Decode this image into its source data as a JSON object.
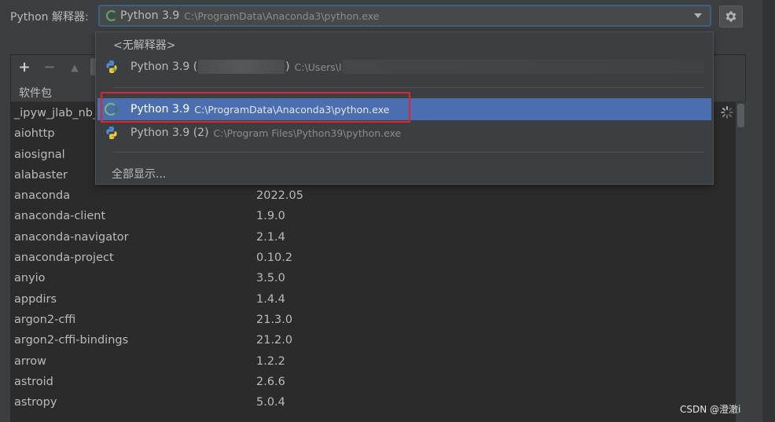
{
  "interpreter": {
    "label": "Python 解释器:",
    "selected_name": "Python 3.9",
    "selected_path": "C:\\ProgramData\\Anaconda3\\python.exe"
  },
  "toolbar": {
    "add": "+",
    "remove": "−",
    "up": "▲"
  },
  "table": {
    "header_package": "软件包",
    "rows": [
      {
        "name": "_ipyw_jlab_nb_",
        "version": ""
      },
      {
        "name": "aiohttp",
        "version": ""
      },
      {
        "name": "aiosignal",
        "version": ""
      },
      {
        "name": "alabaster",
        "version": ""
      },
      {
        "name": "anaconda",
        "version": "2022.05"
      },
      {
        "name": "anaconda-client",
        "version": "1.9.0"
      },
      {
        "name": "anaconda-navigator",
        "version": "2.1.4"
      },
      {
        "name": "anaconda-project",
        "version": "0.10.2"
      },
      {
        "name": "anyio",
        "version": "3.5.0"
      },
      {
        "name": "appdirs",
        "version": "1.4.4"
      },
      {
        "name": "argon2-cffi",
        "version": "21.3.0"
      },
      {
        "name": "argon2-cffi-bindings",
        "version": "21.2.0"
      },
      {
        "name": "arrow",
        "version": "1.2.2"
      },
      {
        "name": "astroid",
        "version": "2.6.6"
      },
      {
        "name": "astropy",
        "version": "5.0.4"
      }
    ]
  },
  "dropdown": {
    "no_interpreter": "<无解释器>",
    "item1_name": "Python 3.9 (",
    "item1_close": ")",
    "item1_path": "C:\\Users\\l",
    "selected_name": "Python 3.9",
    "selected_path": "C:\\ProgramData\\Anaconda3\\python.exe",
    "item3_name": "Python 3.9 (2)",
    "item3_path": "C:\\Program Files\\Python39\\python.exe",
    "show_all": "全部显示..."
  },
  "watermark": "CSDN @澄澈i",
  "colors": {
    "background": "#3c3f41",
    "selection": "#4b6eaf",
    "highlight_box": "#e0262d",
    "focus_border": "#3d6185"
  }
}
